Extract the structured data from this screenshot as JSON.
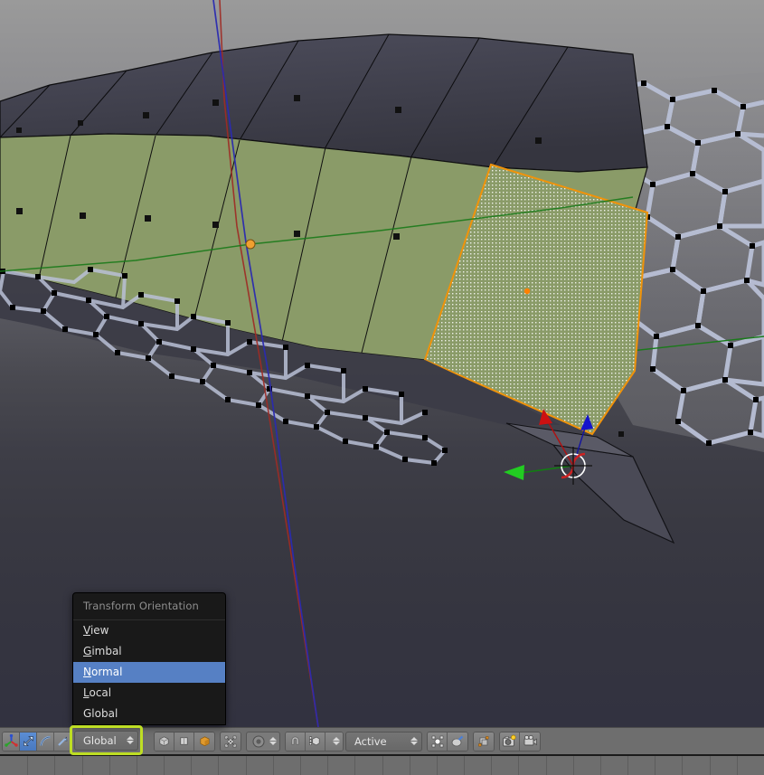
{
  "app": {
    "name": "Blender 3D Viewport",
    "mode": "Edit Mode"
  },
  "viewport": {
    "name": "3d-viewport",
    "background_top": "#9a9a9a",
    "background_bottom": "#323240",
    "selected_face_color": "#8a9b68",
    "active_face_outline": "#f0930a",
    "active_face_dot": "#ff8000",
    "unselected_face_color": "#474754",
    "wire_edge_color": "#b9c0d6",
    "axis_x_color": "#9e2b25",
    "axis_y_color": "#1a7a1a",
    "axis_z_color": "#2a2ab0",
    "manipulator": {
      "name": "transform-manipulator",
      "x_arrow_color": "#cc1111",
      "y_arrow_color": "#22cc22",
      "z_arrow_color": "#1414cc",
      "cursor_color": "#ffffff"
    },
    "origin_dot_color": "#f0a030"
  },
  "menu": {
    "name": "transform-orientation-menu",
    "title": "Transform Orientation",
    "highlight_color": "#5680c4",
    "items": [
      {
        "label": "View",
        "accel": "V",
        "selected": false
      },
      {
        "label": "Gimbal",
        "accel": "G",
        "selected": false
      },
      {
        "label": "Normal",
        "accel": "N",
        "selected": true
      },
      {
        "label": "Local",
        "accel": "L",
        "selected": false
      },
      {
        "label": "Global",
        "accel": "",
        "selected": false
      }
    ]
  },
  "header": {
    "name": "viewport-header",
    "background": "#6e6e6e",
    "manipulator_buttons": [
      {
        "icon": "axis-gizmo-icon",
        "label": "Manipulator",
        "active": false
      },
      {
        "icon": "translate-arrow-icon",
        "label": "Translate",
        "active": true
      },
      {
        "icon": "rotate-arc-icon",
        "label": "Rotate",
        "active": false
      },
      {
        "icon": "scale-arrow-icon",
        "label": "Scale",
        "active": false
      }
    ],
    "orientation": {
      "name": "transform-orientation-dropdown",
      "value": "Global",
      "highlight_border": "#bede24"
    },
    "shading_buttons": [
      {
        "icon": "bounding-box-icon",
        "label": "Bounding Box",
        "active": false
      },
      {
        "icon": "wireframe-icon",
        "label": "Wireframe",
        "active": false
      },
      {
        "icon": "solid-shading-icon",
        "label": "Solid",
        "active": true
      }
    ],
    "pivot": {
      "icon": "pivot-point-icon",
      "label": "Pivot Point"
    },
    "proportional": {
      "icon": "proportional-edit-icon",
      "label": "Proportional Editing"
    },
    "snap": {
      "magnet": {
        "icon": "magnet-icon",
        "label": "Snap During Transform",
        "active": false
      },
      "element": {
        "icon": "snap-element-icon",
        "label": "Snap Element"
      },
      "target": {
        "name": "snap-target-dropdown",
        "value": "Active"
      }
    },
    "overlays": [
      {
        "icon": "occlude-geometry-icon",
        "label": "Limit Selection to Visible"
      },
      {
        "icon": "texture-paint-icon",
        "label": "Texture Paint Mode"
      }
    ],
    "extras": [
      {
        "icon": "render-layers-icon",
        "label": "Render Layers"
      },
      {
        "icon": "render-image-icon",
        "label": "Render Image"
      },
      {
        "icon": "render-anim-icon",
        "label": "Render Animation"
      }
    ]
  },
  "timeline": {
    "name": "timeline-strip",
    "background": "#6e6e6e",
    "tick_count": 28
  }
}
